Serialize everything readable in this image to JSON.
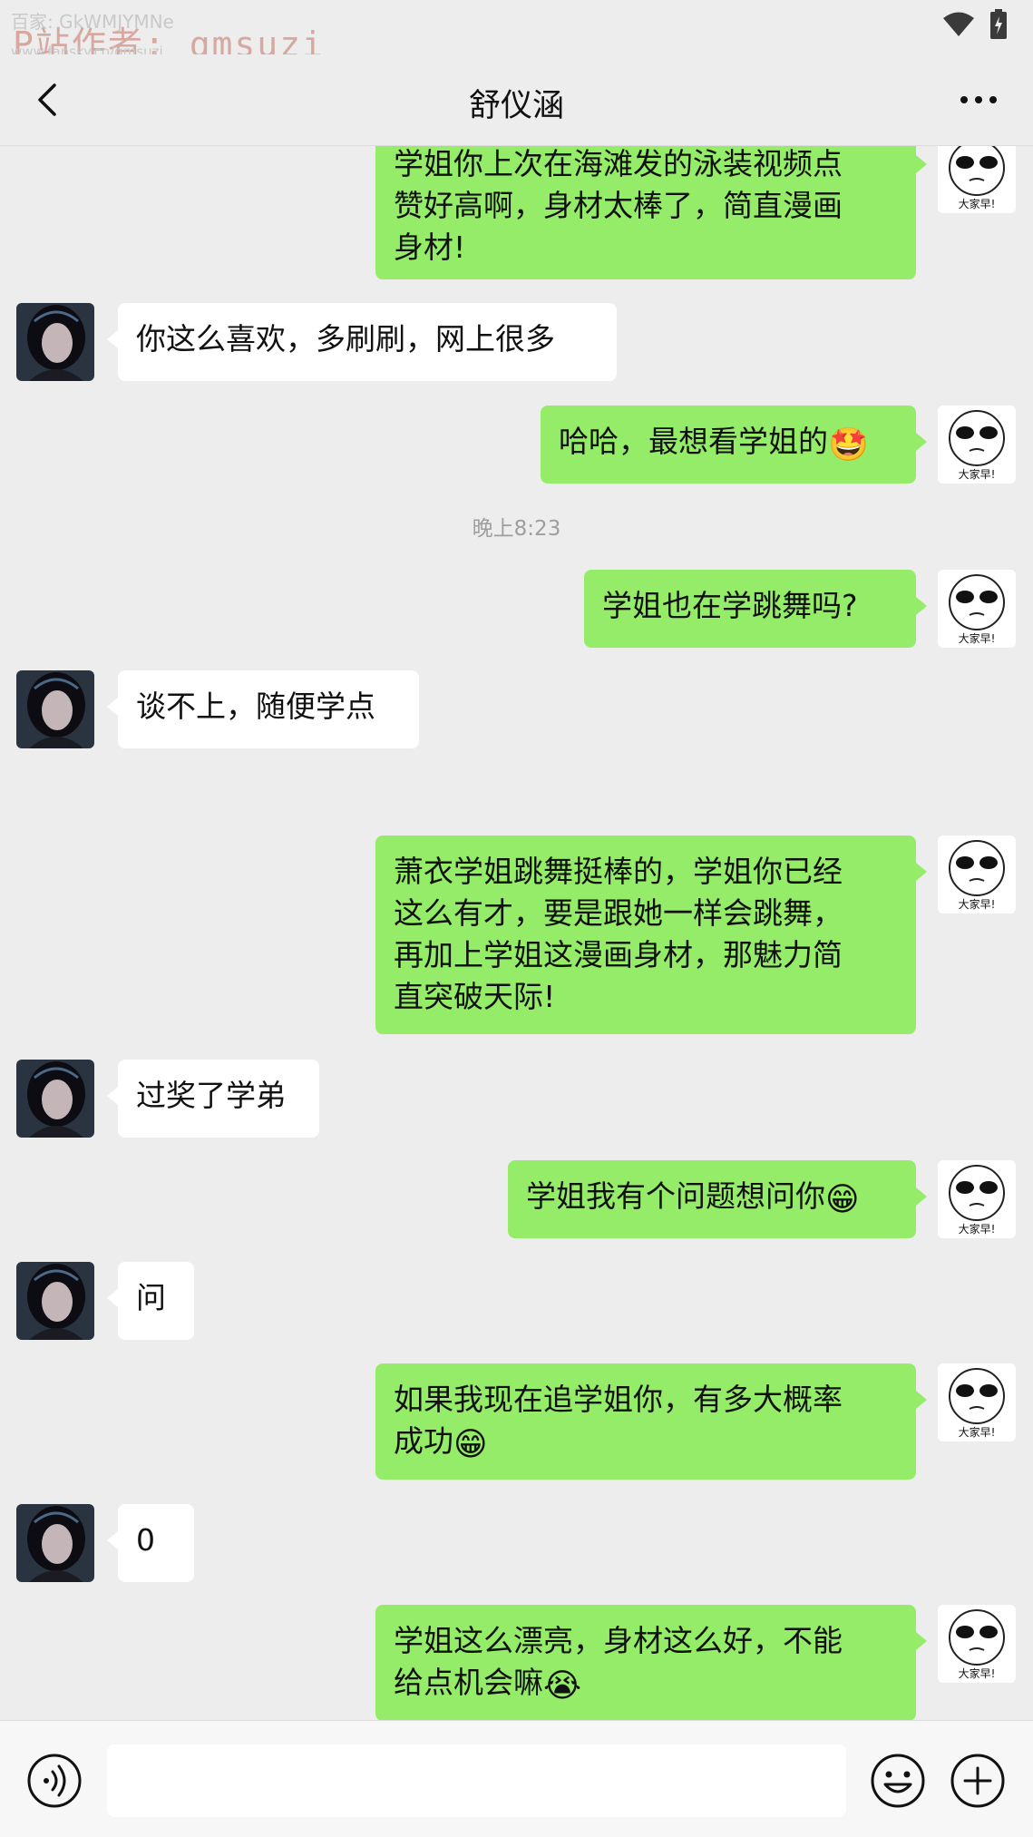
{
  "status_bar": {
    "watermark_line1": "百家: GkWMJYMNe",
    "watermark_line2": "P站作者: qmsuzi",
    "watermark_line3": "www.fansky.co/qmsuzi",
    "icons": [
      "wifi-icon",
      "battery-icon"
    ]
  },
  "nav": {
    "title": "舒仪涵",
    "back_icon": "chevron-left-icon",
    "more_icon": "more-dots-icon"
  },
  "my_avatar_caption": "大家早!",
  "messages": [
    {
      "from": "me",
      "text": "学姐你上次在海滩发的泳装视频点\n赞好高啊，身材太棒了，简直漫画\n身材!"
    },
    {
      "from": "her",
      "text": "你这么喜欢，多刷刷，网上很多"
    },
    {
      "from": "me",
      "text": "哈哈，最想看学姐的",
      "emoji": "🤩"
    },
    {
      "from": "time",
      "text": "晚上8:23"
    },
    {
      "from": "me",
      "text": "学姐也在学跳舞吗?"
    },
    {
      "from": "her",
      "text": "谈不上，随便学点"
    },
    {
      "from": "me",
      "text": "萧衣学姐跳舞挺棒的，学姐你已经\n这么有才，要是跟她一样会跳舞，\n再加上学姐这漫画身材，那魅力简\n直突破天际!"
    },
    {
      "from": "her",
      "text": "过奖了学弟"
    },
    {
      "from": "me",
      "text": "学姐我有个问题想问你",
      "emoji": "😁"
    },
    {
      "from": "her",
      "text": "问"
    },
    {
      "from": "me",
      "text": "如果我现在追学姐你，有多大概率\n成功",
      "emoji": "😁"
    },
    {
      "from": "her",
      "text": "0"
    },
    {
      "from": "me",
      "text": "学姐这么漂亮，身材这么好，不能\n给点机会嘛",
      "emoji": "😭"
    }
  ],
  "input_bar": {
    "voice_icon": "voice-icon",
    "input_value": "",
    "emoji_icon": "smiley-icon",
    "plus_icon": "plus-circle-icon"
  },
  "colors": {
    "background": "#ededed",
    "my_bubble": "#95ec69",
    "her_bubble": "#ffffff",
    "timestamp": "#9e9e9e"
  }
}
